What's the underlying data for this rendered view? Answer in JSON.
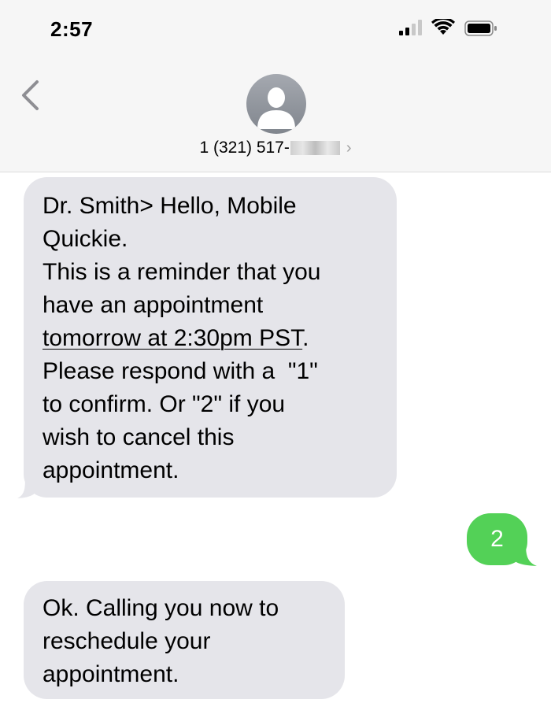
{
  "status_bar": {
    "time": "2:57",
    "icons": [
      "signal-icon",
      "wifi-icon",
      "battery-icon"
    ]
  },
  "header": {
    "back_icon": "chevron-left-icon",
    "avatar_icon": "person-silhouette-icon",
    "contact_number": "1 (321) 517-",
    "chevron": "›"
  },
  "messages": [
    {
      "direction": "incoming",
      "text_before_underline": "Dr. Smith> Hello, Mobile\nQuickie.\nThis is a reminder that you\nhave an appointment\n",
      "text_underlined": "tomorrow at 2:30pm PST",
      "text_after_underline": ".\nPlease respond with a  \"1\"\nto confirm. Or \"2\" if you\nwish to cancel this\nappointment."
    },
    {
      "direction": "outgoing",
      "text": "2"
    },
    {
      "direction": "incoming",
      "text": "Ok. Calling you now to\nreschedule your\nappointment."
    }
  ],
  "colors": {
    "header_bg": "#f6f6f6",
    "incoming_bubble": "#e5e5ea",
    "outgoing_bubble": "#53d157",
    "accent_gray": "#8e8e93"
  }
}
